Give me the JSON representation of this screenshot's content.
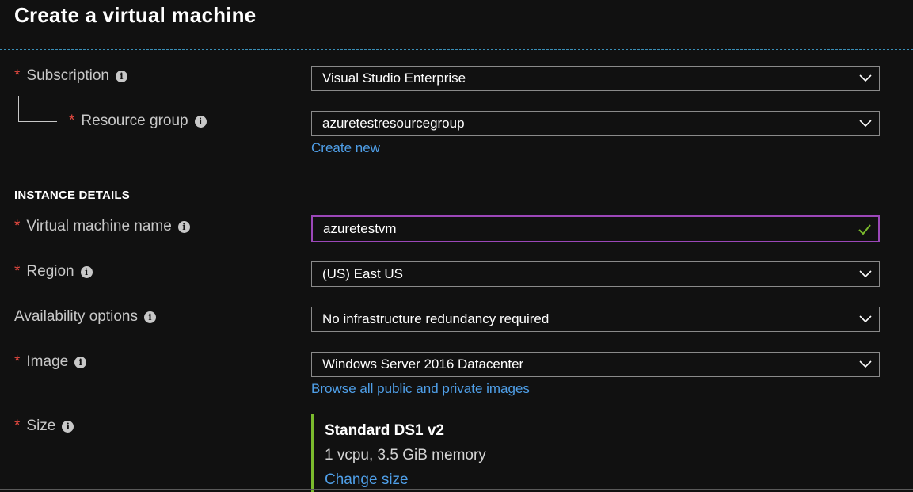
{
  "page": {
    "title": "Create a virtual machine"
  },
  "project": {
    "subscription": {
      "label": "Subscription",
      "value": "Visual Studio Enterprise",
      "icon": "info-icon"
    },
    "resource_group": {
      "label": "Resource group",
      "value": "azuretestresourcegroup",
      "create_new_label": "Create new",
      "icon": "info-icon"
    }
  },
  "instance": {
    "heading": "INSTANCE DETAILS",
    "vm_name": {
      "label": "Virtual machine name",
      "value": "azuretestvm",
      "valid_icon": "checkmark-icon"
    },
    "region": {
      "label": "Region",
      "value": "(US) East US"
    },
    "availability": {
      "label": "Availability options",
      "value": "No infrastructure redundancy required"
    },
    "image": {
      "label": "Image",
      "value": "Windows Server 2016 Datacenter",
      "browse_label": "Browse all public and private images"
    },
    "size": {
      "label": "Size",
      "name": "Standard DS1 v2",
      "detail": "1 vcpu, 3.5 GiB memory",
      "change_label": "Change size"
    }
  },
  "required_marker": "*",
  "colors": {
    "background": "#111111",
    "required": "#e0483f",
    "link": "#4f9fe8",
    "focus_border": "#9b47b8",
    "valid_check": "#7bbb2d",
    "size_accent": "#7bbb2d"
  }
}
